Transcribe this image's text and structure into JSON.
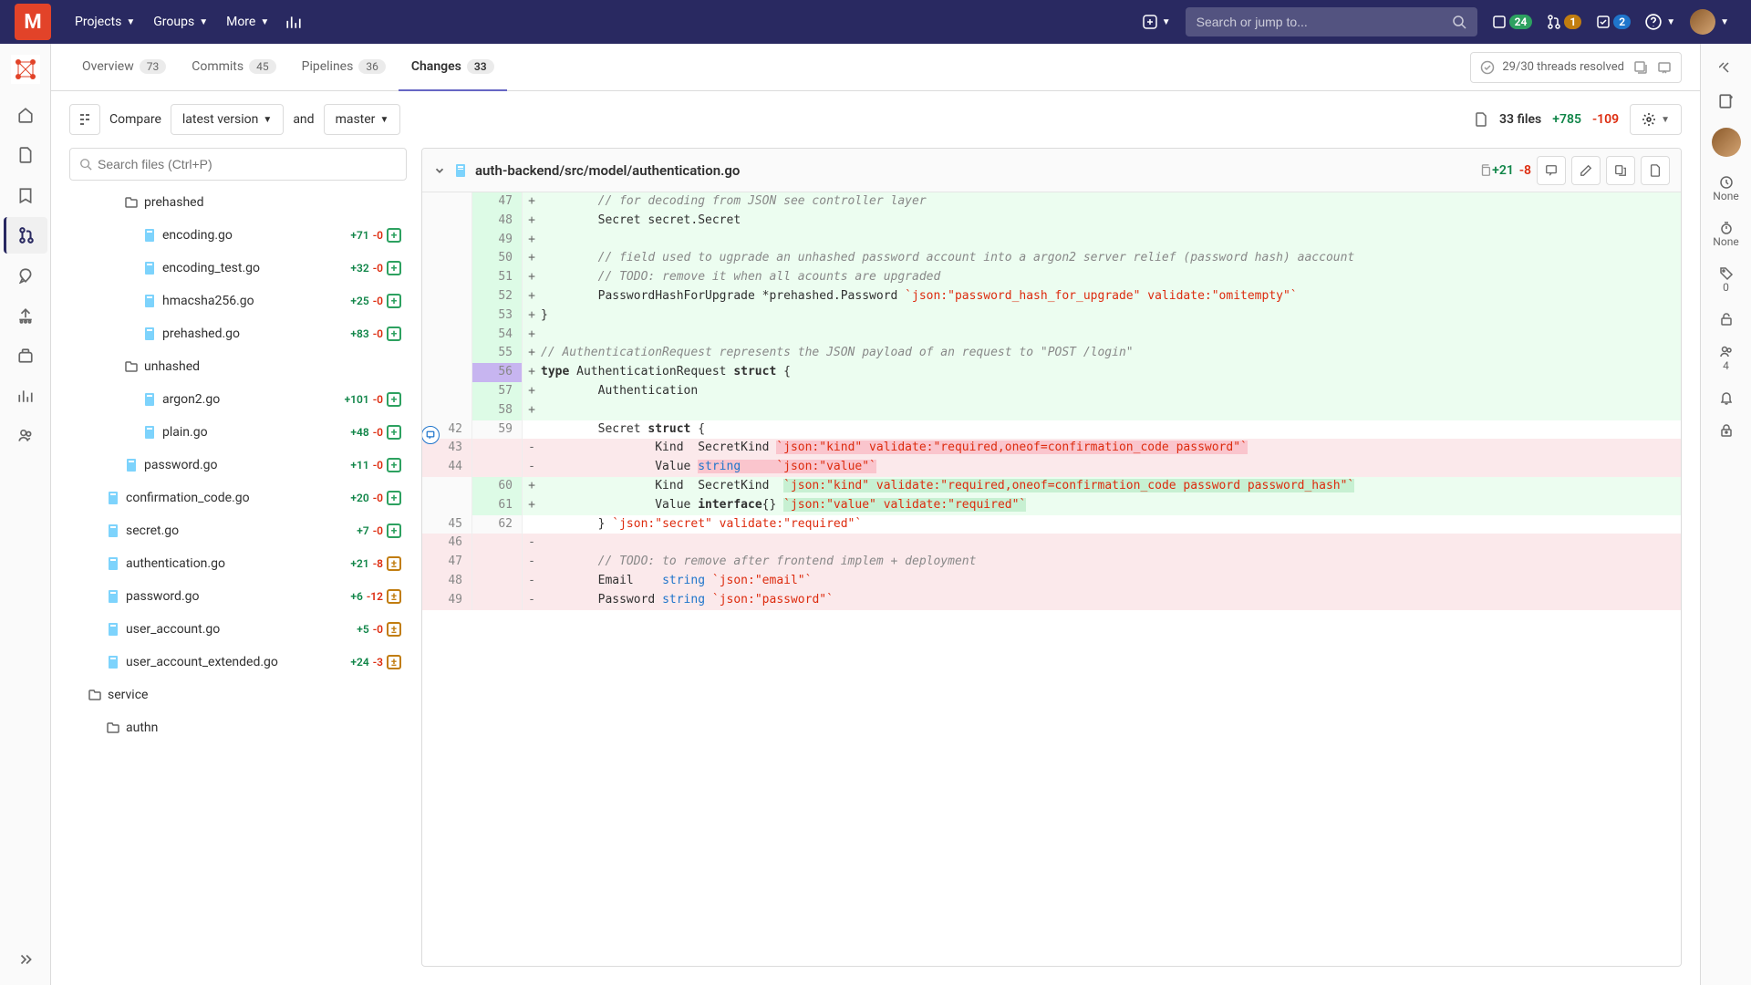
{
  "nav": {
    "projects": "Projects",
    "groups": "Groups",
    "more": "More",
    "search_placeholder": "Search or jump to...",
    "badge_todo": "24",
    "badge_mr": "1",
    "badge_review": "2"
  },
  "tabs": {
    "overview": "Overview",
    "overview_n": "73",
    "commits": "Commits",
    "commits_n": "45",
    "pipelines": "Pipelines",
    "pipelines_n": "36",
    "changes": "Changes",
    "changes_n": "33"
  },
  "threads": "29/30 threads resolved",
  "toolbar": {
    "compare": "Compare",
    "version": "latest version",
    "and": "and",
    "target": "master",
    "files": "33 files",
    "additions": "+785",
    "deletions": "-109"
  },
  "files": {
    "search_placeholder": "Search files (Ctrl+P)"
  },
  "tree": [
    {
      "type": "folder",
      "indent": 2,
      "name": "prehashed"
    },
    {
      "type": "file",
      "indent": 3,
      "name": "encoding.go",
      "add": "+71",
      "del": "-0",
      "mark": "green"
    },
    {
      "type": "file",
      "indent": 3,
      "name": "encoding_test.go",
      "add": "+32",
      "del": "-0",
      "mark": "green"
    },
    {
      "type": "file",
      "indent": 3,
      "name": "hmacsha256.go",
      "add": "+25",
      "del": "-0",
      "mark": "green"
    },
    {
      "type": "file",
      "indent": 3,
      "name": "prehashed.go",
      "add": "+83",
      "del": "-0",
      "mark": "green"
    },
    {
      "type": "folder",
      "indent": 2,
      "name": "unhashed"
    },
    {
      "type": "file",
      "indent": 3,
      "name": "argon2.go",
      "add": "+101",
      "del": "-0",
      "mark": "green"
    },
    {
      "type": "file",
      "indent": 3,
      "name": "plain.go",
      "add": "+48",
      "del": "-0",
      "mark": "green"
    },
    {
      "type": "file",
      "indent": 2,
      "name": "password.go",
      "add": "+11",
      "del": "-0",
      "mark": "green"
    },
    {
      "type": "file",
      "indent": 1,
      "name": "confirmation_code.go",
      "add": "+20",
      "del": "-0",
      "mark": "green"
    },
    {
      "type": "file",
      "indent": 1,
      "name": "secret.go",
      "add": "+7",
      "del": "-0",
      "mark": "green"
    },
    {
      "type": "file",
      "indent": 1,
      "name": "authentication.go",
      "add": "+21",
      "del": "-8",
      "mark": "orange"
    },
    {
      "type": "file",
      "indent": 1,
      "name": "password.go",
      "add": "+6",
      "del": "-12",
      "mark": "orange"
    },
    {
      "type": "file",
      "indent": 1,
      "name": "user_account.go",
      "add": "+5",
      "del": "-0",
      "mark": "orange"
    },
    {
      "type": "file",
      "indent": 1,
      "name": "user_account_extended.go",
      "add": "+24",
      "del": "-3",
      "mark": "orange"
    },
    {
      "type": "folder",
      "indent": 0,
      "name": "service"
    },
    {
      "type": "folder",
      "indent": 1,
      "name": "authn"
    }
  ],
  "diff": {
    "path": "auth-backend/src/model/authentication.go",
    "add": "+21",
    "del": "-8",
    "lines": [
      {
        "o": "",
        "n": "47",
        "s": "+",
        "cls": "add",
        "text": "        // for decoding from JSON see controller layer",
        "kind": "comment"
      },
      {
        "o": "",
        "n": "48",
        "s": "+",
        "cls": "add",
        "text": "        Secret secret.Secret"
      },
      {
        "o": "",
        "n": "49",
        "s": "+",
        "cls": "add",
        "text": ""
      },
      {
        "o": "",
        "n": "50",
        "s": "+",
        "cls": "add",
        "text": "        // field used to ugprade an unhashed password account into a argon2 server relief (password hash) aaccount",
        "kind": "comment"
      },
      {
        "o": "",
        "n": "51",
        "s": "+",
        "cls": "add",
        "text": "        // TODO: remove it when all acounts are upgraded",
        "kind": "comment"
      },
      {
        "o": "",
        "n": "52",
        "s": "+",
        "cls": "add",
        "html": "        PasswordHashForUpgrade *prehashed.Password <span class='cc-str'>`json:\"password_hash_for_upgrade\" validate:\"omitempty\"`</span>"
      },
      {
        "o": "",
        "n": "53",
        "s": "+",
        "cls": "add",
        "text": "}"
      },
      {
        "o": "",
        "n": "54",
        "s": "+",
        "cls": "add",
        "text": ""
      },
      {
        "o": "",
        "n": "55",
        "s": "+",
        "cls": "add",
        "html": "<span class='cc-comment'>// AuthenticationRequest represents the JSON payload of an request to \"POST /login\"</span>"
      },
      {
        "o": "",
        "n": "56",
        "s": "+",
        "cls": "add hl56",
        "html": "<span class='cc-kw'>type</span> AuthenticationRequest <span class='cc-kw'>struct</span> {"
      },
      {
        "o": "",
        "n": "57",
        "s": "+",
        "cls": "add",
        "text": "        Authentication"
      },
      {
        "o": "",
        "n": "58",
        "s": "+",
        "cls": "add",
        "text": ""
      },
      {
        "o": "42",
        "n": "59",
        "s": "",
        "cls": "",
        "html": "        Secret <span class='cc-kw'>struct</span> {"
      },
      {
        "o": "43",
        "n": "",
        "s": "-",
        "cls": "del",
        "html": "                Kind  SecretKind <span class='cc-hl-r'><span class='cc-str'>`json:\"kind\" validate:\"required,oneof=confirmation_code password\"`</span></span>"
      },
      {
        "o": "44",
        "n": "",
        "s": "-",
        "cls": "del",
        "html": "                Value <span class='cc-hl-r'><span class='cc-type'>string</span>     <span class='cc-str'>`json:\"value\"`</span></span>"
      },
      {
        "o": "",
        "n": "60",
        "s": "+",
        "cls": "add",
        "html": "                Kind  SecretKind  <span class='cc-hl-g'><span class='cc-str'>`json:\"kind\" validate:\"required,oneof=confirmation_code password password_hash\"`</span></span>"
      },
      {
        "o": "",
        "n": "61",
        "s": "+",
        "cls": "add",
        "html": "                Value <span class='cc-kw'>interface</span>{} <span class='cc-hl-g'><span class='cc-str'>`json:\"value\" validate:\"required\"`</span></span>"
      },
      {
        "o": "45",
        "n": "62",
        "s": "",
        "cls": "",
        "html": "        } <span class='cc-str'>`json:\"secret\" validate:\"required\"`</span>"
      },
      {
        "o": "46",
        "n": "",
        "s": "-",
        "cls": "del",
        "text": ""
      },
      {
        "o": "47",
        "n": "",
        "s": "-",
        "cls": "del",
        "html": "        <span class='cc-comment'>// TODO: to remove after frontend implem + deployment</span>"
      },
      {
        "o": "48",
        "n": "",
        "s": "-",
        "cls": "del",
        "html": "        Email    <span class='cc-type'>string</span> <span class='cc-str'>`json:\"email\"`</span>"
      },
      {
        "o": "49",
        "n": "",
        "s": "-",
        "cls": "del",
        "html": "        Password <span class='cc-type'>string</span> <span class='cc-str'>`json:\"password\"`</span>"
      }
    ]
  },
  "right": {
    "none1": "None",
    "none2": "None",
    "zero": "0",
    "four": "4"
  }
}
